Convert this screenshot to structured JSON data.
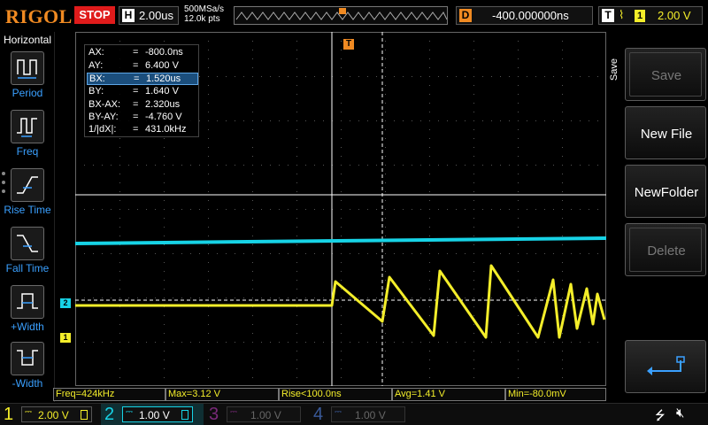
{
  "brand": {
    "logo": "RIGOL",
    "run_state": "STOP"
  },
  "horizontal": {
    "label": "H",
    "timebase": "2.00us",
    "sample_rate": "500MSa/s",
    "points": "12.0k pts"
  },
  "trigger_strip": {
    "marker": "T"
  },
  "delay": {
    "label": "D",
    "value": "-400.000000ns"
  },
  "trigger": {
    "label": "T",
    "edge_symbol": "⌇",
    "source": "1",
    "level": "2.00 V"
  },
  "left_menu": {
    "title": "Horizontal",
    "items": [
      {
        "label": "Period",
        "icon": "period-icon"
      },
      {
        "label": "Freq",
        "icon": "freq-icon"
      },
      {
        "label": "Rise Time",
        "icon": "rise-time-icon"
      },
      {
        "label": "Fall Time",
        "icon": "fall-time-icon"
      },
      {
        "label": "+Width",
        "icon": "pos-width-icon"
      },
      {
        "label": "-Width",
        "icon": "neg-width-icon"
      }
    ]
  },
  "cursor_readout": {
    "rows": [
      {
        "label": "AX:",
        "eq": "=",
        "value": "-800.0ns"
      },
      {
        "label": "AY:",
        "eq": "=",
        "value": "6.400 V"
      },
      {
        "label": "BX:",
        "eq": "=",
        "value": "1.520us",
        "selected": true
      },
      {
        "label": "BY:",
        "eq": "=",
        "value": "1.640 V"
      },
      {
        "label": "BX-AX:",
        "eq": "=",
        "value": "2.320us"
      },
      {
        "label": "BY-AY:",
        "eq": "=",
        "value": "-4.760 V"
      },
      {
        "label": "1/|dX|:",
        "eq": "=",
        "value": "431.0kHz"
      }
    ]
  },
  "right_menu": {
    "title": "Save",
    "keys": [
      {
        "label": "Save",
        "enabled": false
      },
      {
        "label": "New File",
        "enabled": true
      },
      {
        "label": "NewFolder",
        "enabled": true
      },
      {
        "label": "Delete",
        "enabled": false
      },
      {
        "label": "",
        "enabled": true,
        "icon": "return-arrow-icon"
      }
    ]
  },
  "markers": {
    "ch2_ground": "2",
    "ch1_ground": "1",
    "trigger_top": "T",
    "trigger_level": "T"
  },
  "measurements": [
    {
      "text": "Freq=424kHz"
    },
    {
      "text": "Max=3.12 V"
    },
    {
      "text": "Rise<100.0ns"
    },
    {
      "text": "Avg=1.41 V"
    },
    {
      "text": "Min=-80.0mV"
    }
  ],
  "channels": [
    {
      "num": "1",
      "coupling": "⎓",
      "scale": "2.00 V",
      "color": "#f4ee2a",
      "active": true
    },
    {
      "num": "2",
      "coupling": "⎓",
      "scale": "1.00 V",
      "color": "#17d3e6",
      "active": true
    },
    {
      "num": "3",
      "coupling": "⎓",
      "scale": "1.00 V",
      "color": "#d02cd0",
      "active": false
    },
    {
      "num": "4",
      "coupling": "⎓",
      "scale": "1.00 V",
      "color": "#3a6ad8",
      "active": false
    }
  ],
  "status_icons": {
    "usb": "usb-icon",
    "speaker": "speaker-mute-icon"
  },
  "colors": {
    "ch1": "#f4ee2a",
    "ch2": "#17d3e6",
    "accent": "#f08a22",
    "stop": "#e01b1b",
    "menu_label": "#3aa0ff"
  }
}
